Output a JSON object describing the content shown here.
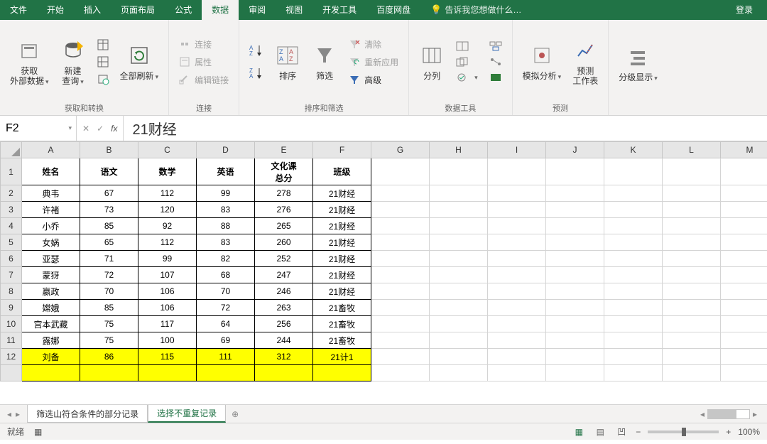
{
  "menu": [
    "文件",
    "开始",
    "插入",
    "页面布局",
    "公式",
    "数据",
    "审阅",
    "视图",
    "开发工具",
    "百度网盘"
  ],
  "menu_active_index": 5,
  "tell_me": "告诉我您想做什么…",
  "login": "登录",
  "ribbon": {
    "g1": {
      "title": "获取和转换",
      "b1": "获取\n外部数据",
      "b2": "新建\n查询",
      "b3": "全部刷新"
    },
    "g2": {
      "title": "连接",
      "i1": "连接",
      "i2": "属性",
      "i3": "编辑链接"
    },
    "g3": {
      "title": "排序和筛选",
      "b1": "排序",
      "b2": "筛选",
      "i1": "清除",
      "i2": "重新应用",
      "i3": "高级"
    },
    "g4": {
      "title": "数据工具",
      "b1": "分列"
    },
    "g5": {
      "title": "预测",
      "b1": "模拟分析",
      "b2": "预测\n工作表"
    },
    "g6": {
      "title": "",
      "b1": "分级显示"
    }
  },
  "name_box": "F2",
  "formula_value": "21财经",
  "columns": [
    "A",
    "B",
    "C",
    "D",
    "E",
    "F",
    "G",
    "H",
    "I",
    "J",
    "K",
    "L",
    "M"
  ],
  "headers": [
    "姓名",
    "语文",
    "数学",
    "英语",
    "文化课\n总分",
    "班级"
  ],
  "rows": [
    {
      "n": "典韦",
      "a": 67,
      "b": 112,
      "c": 99,
      "d": 278,
      "e": "21财经"
    },
    {
      "n": "许褚",
      "a": 73,
      "b": 120,
      "c": 83,
      "d": 276,
      "e": "21财经"
    },
    {
      "n": "小乔",
      "a": 85,
      "b": 92,
      "c": 88,
      "d": 265,
      "e": "21财经"
    },
    {
      "n": "女娲",
      "a": 65,
      "b": 112,
      "c": 83,
      "d": 260,
      "e": "21财经"
    },
    {
      "n": "亚瑟",
      "a": 71,
      "b": 99,
      "c": 82,
      "d": 252,
      "e": "21财经"
    },
    {
      "n": "蒙犽",
      "a": 72,
      "b": 107,
      "c": 68,
      "d": 247,
      "e": "21财经"
    },
    {
      "n": "嬴政",
      "a": 70,
      "b": 106,
      "c": 70,
      "d": 246,
      "e": "21财经"
    },
    {
      "n": "嫦娥",
      "a": 85,
      "b": 106,
      "c": 72,
      "d": 263,
      "e": "21畜牧"
    },
    {
      "n": "宫本武藏",
      "a": 75,
      "b": 117,
      "c": 64,
      "d": 256,
      "e": "21畜牧"
    },
    {
      "n": "露娜",
      "a": 75,
      "b": 100,
      "c": 69,
      "d": 244,
      "e": "21畜牧"
    },
    {
      "n": "刘备",
      "a": 86,
      "b": 115,
      "c": 111,
      "d": 312,
      "e": "21计1"
    }
  ],
  "highlight_row_index": 10,
  "sheet_tabs": {
    "t1": "筛选山符合条件的部分记录",
    "t2": "选择不重复记录"
  },
  "status": "就绪",
  "zoom": "100%"
}
